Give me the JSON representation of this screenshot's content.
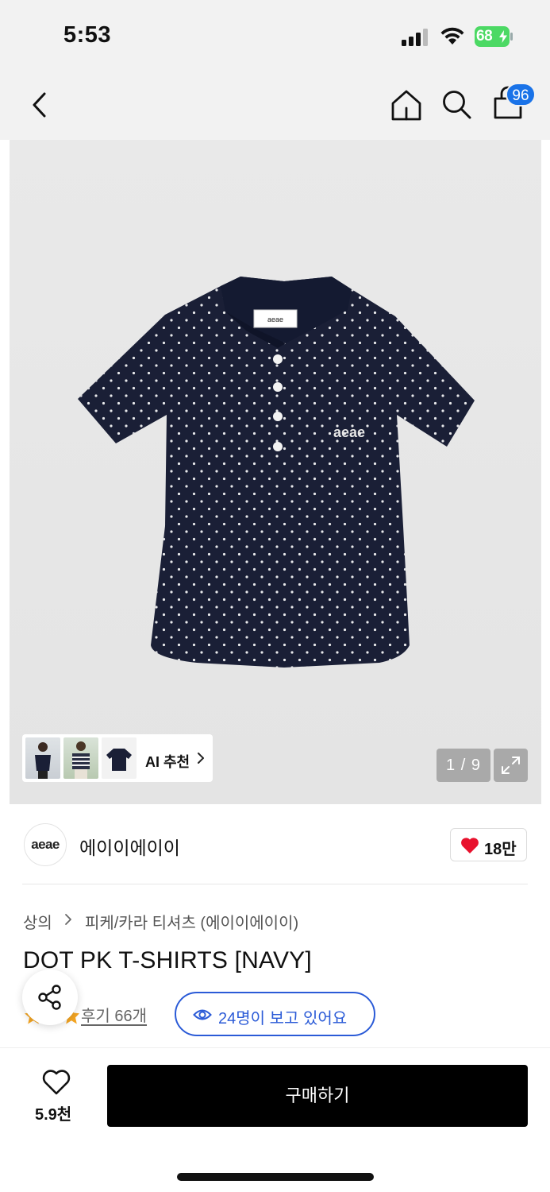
{
  "status_bar": {
    "time": "5:53",
    "battery": "68"
  },
  "nav": {
    "cart_count": "96"
  },
  "gallery": {
    "ai_recommend_label": "AI 추천",
    "page_indicator": "1 / 9",
    "shirt_tag_text": "aeae",
    "shirt_color": "#1a1f36"
  },
  "brand": {
    "logo_text": "aeae",
    "name": "에이이에이이",
    "like_count": "18만"
  },
  "breadcrumb": {
    "category": "상의",
    "subcategory": "피케/카라 티셔츠 (에이이에이이)"
  },
  "product": {
    "title": "DOT PK T-SHIRTS [NAVY]",
    "review_label": "후기 66개",
    "viewers_label": "24명이 보고 있어요"
  },
  "bottom_bar": {
    "wish_count": "5.9천",
    "buy_label": "구매하기"
  },
  "colors": {
    "accent_blue": "#2b5bd7",
    "badge_blue": "#1a73e8",
    "heart_red": "#e8112d",
    "buy_button": "#000000"
  }
}
